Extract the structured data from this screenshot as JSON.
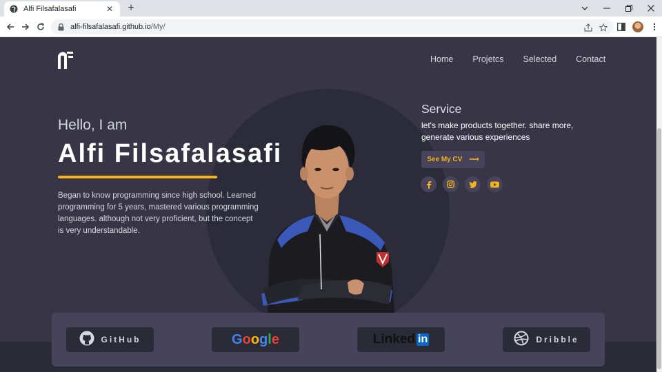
{
  "browser": {
    "tab_title": "Alfi Filsafalasafi",
    "tab_close": "✕",
    "new_tab": "+",
    "url_host": "alfi-filsafalasafi.github.io",
    "url_path": "/My/",
    "window_buttons": {
      "minimize": "—",
      "restore": "❐",
      "close": "✕",
      "tabsearch": "⌄"
    }
  },
  "nav": {
    "items": [
      "Home",
      "Projetcs",
      "Selected",
      "Contact"
    ]
  },
  "hero": {
    "greeting": "Hello, I am",
    "name": "Alfi Filsafalasafi",
    "description": "Began to know programming since high school. Learned programming for 5 years, mastered various programming languages. although not very proficient, but the concept is very understandable."
  },
  "service": {
    "title": "Service",
    "text": "let's make products together. share more, generate various experiences",
    "cv_button": "See My CV",
    "cv_arrow": "⟶",
    "socials": [
      "facebook-icon",
      "instagram-icon",
      "twitter-icon",
      "youtube-icon"
    ]
  },
  "partners": {
    "github": "GitHub",
    "google": [
      "G",
      "o",
      "o",
      "g",
      "l",
      "e"
    ],
    "google_colors": [
      "#4285f4",
      "#ea4335",
      "#fbbc05",
      "#4285f4",
      "#34a853",
      "#ea4335"
    ],
    "linkedin_word": "Linked",
    "linkedin_in": "in",
    "dribble": "Dribble"
  },
  "colors": {
    "accent": "#f5b21b",
    "background": "#373546",
    "card": "#46435a",
    "button_dark": "#2b2a37"
  }
}
